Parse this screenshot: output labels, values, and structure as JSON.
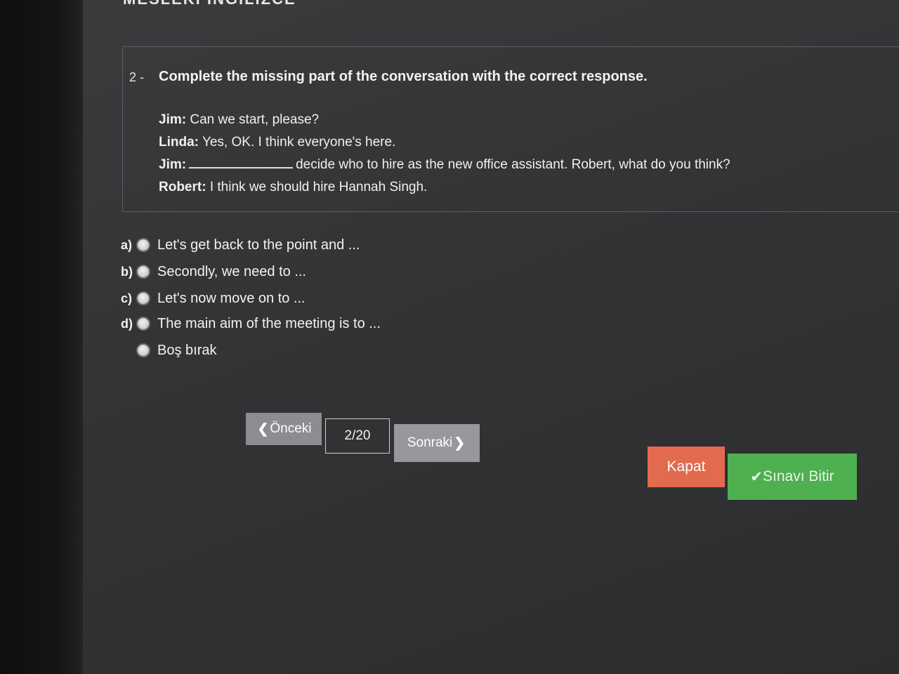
{
  "header": {
    "fragment": "MESLEKİ İNGİLİZCE"
  },
  "question": {
    "number": "2 -",
    "title": "Complete the missing part of the conversation with the correct response.",
    "dialog": [
      {
        "speaker": "Jim:",
        "text": "Can we start, please?"
      },
      {
        "speaker": "Linda:",
        "text": "Yes, OK. I think everyone's here."
      },
      {
        "speaker": "Jim:",
        "text": "decide who to hire as the new office assistant. Robert, what do you think?"
      },
      {
        "speaker": "Robert:",
        "text": "I think we should hire Hannah Singh."
      }
    ]
  },
  "options": [
    {
      "letter": "a)",
      "text": "Let's get back to the point and ..."
    },
    {
      "letter": "b)",
      "text": "Secondly, we need to ..."
    },
    {
      "letter": "c)",
      "text": "Let's now move on to ..."
    },
    {
      "letter": "d)",
      "text": "The main aim of the meeting is to ..."
    },
    {
      "letter": "",
      "text": "Boş bırak"
    }
  ],
  "navigation": {
    "prev_label": "Önceki",
    "page": "2/20",
    "next_label": "Sonraki"
  },
  "actions": {
    "close_label": "Kapat",
    "finish_label": "Sınavı Bitir"
  },
  "colors": {
    "close": "#e26a4f",
    "finish": "#4eb04f",
    "nav": "#8c8d90"
  }
}
